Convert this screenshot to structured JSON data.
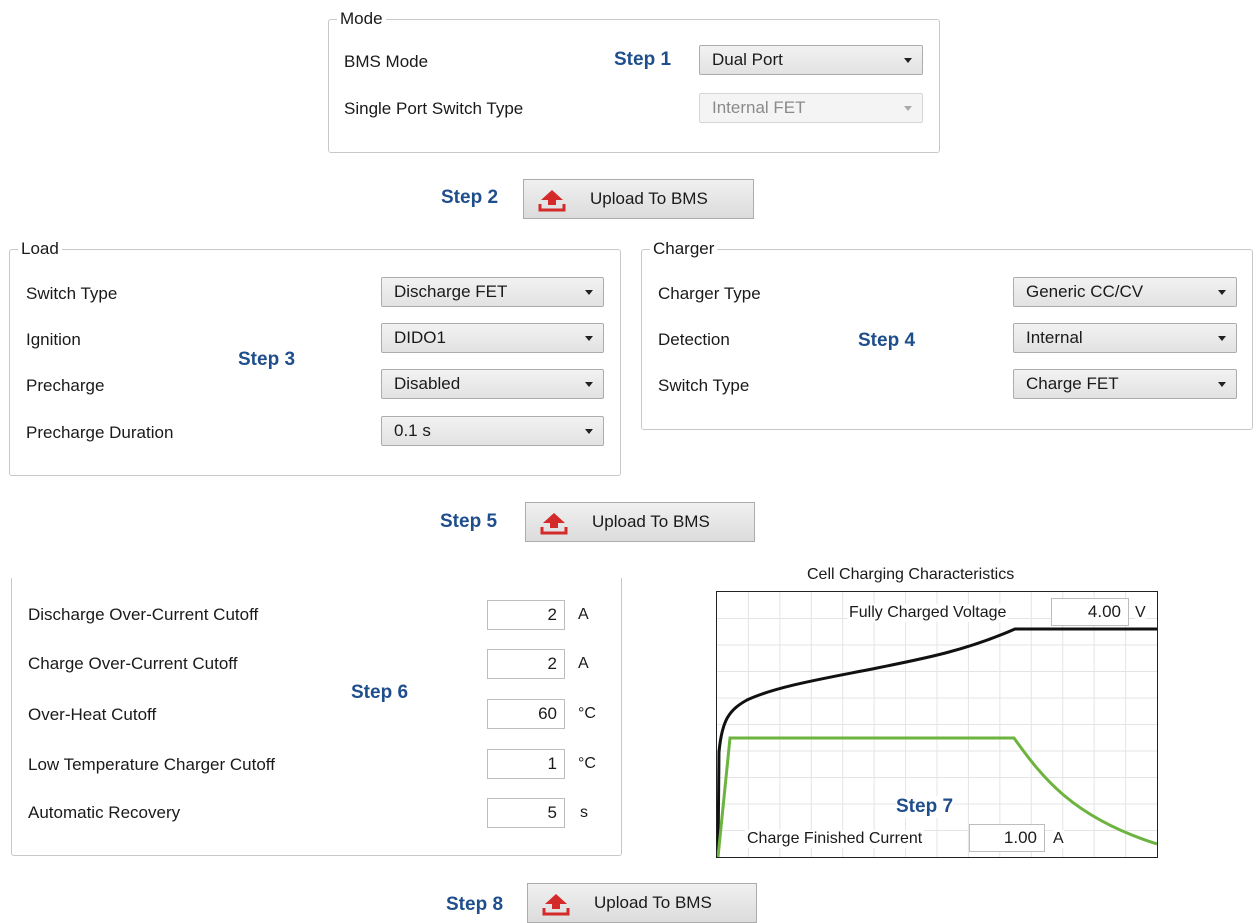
{
  "mode": {
    "title": "Mode",
    "bms_mode_label": "BMS Mode",
    "bms_mode_value": "Dual Port",
    "single_port_label": "Single Port Switch Type",
    "single_port_value": "Internal FET"
  },
  "steps": {
    "s1": "Step 1",
    "s2": "Step 2",
    "s3": "Step 3",
    "s4": "Step 4",
    "s5": "Step 5",
    "s6": "Step 6",
    "s7": "Step 7",
    "s8": "Step 8"
  },
  "upload_label": "Upload To BMS",
  "load": {
    "title": "Load",
    "rows": [
      {
        "label": "Switch Type",
        "value": "Discharge FET"
      },
      {
        "label": "Ignition",
        "value": "DIDO1"
      },
      {
        "label": "Precharge",
        "value": "Disabled"
      },
      {
        "label": "Precharge Duration",
        "value": "0.1 s"
      }
    ]
  },
  "charger": {
    "title": "Charger",
    "rows": [
      {
        "label": "Charger Type",
        "value": "Generic CC/CV"
      },
      {
        "label": "Detection",
        "value": "Internal"
      },
      {
        "label": "Switch Type",
        "value": "Charge FET"
      }
    ]
  },
  "protection": {
    "rows": [
      {
        "label": "Discharge Over-Current Cutoff",
        "value": "2",
        "unit": "A"
      },
      {
        "label": "Charge Over-Current Cutoff",
        "value": "2",
        "unit": "A"
      },
      {
        "label": "Over-Heat Cutoff",
        "value": "60",
        "unit": "°C"
      },
      {
        "label": "Low Temperature Charger Cutoff",
        "value": "1",
        "unit": "°C"
      },
      {
        "label": "Automatic Recovery",
        "value": "5",
        "unit": "s"
      }
    ]
  },
  "chart": {
    "title": "Cell Charging Characteristics",
    "fully_charged_label": "Fully Charged Voltage",
    "fully_charged_value": "4.00",
    "fully_charged_unit": "V",
    "charge_finished_label": "Charge Finished Current",
    "charge_finished_value": "1.00",
    "charge_finished_unit": "A",
    "voltage_color": "#111111",
    "current_color": "#6db33f",
    "grid": true
  }
}
